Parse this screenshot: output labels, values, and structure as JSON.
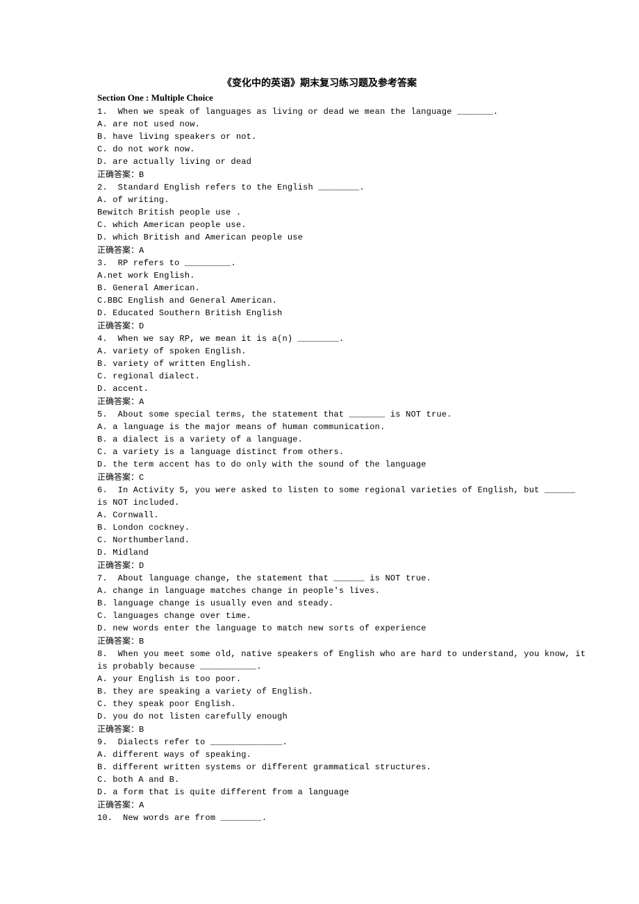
{
  "title": "《变化中的英语》期末复习练习题及参考答案",
  "section_title": "Section One : Multiple Choice",
  "questions": [
    {
      "num": "1.",
      "stem": "When we speak of languages as living or dead we mean the language _______.",
      "opts": [
        "A. are not used now.",
        "B. have living speakers or not.",
        "C. do not work now.",
        "D. are actually living or dead"
      ],
      "ans_label": "正确答案：",
      "ans": "B"
    },
    {
      "num": "2.",
      "stem": "Standard English refers to the English ________.",
      "opts": [
        "A. of writing.",
        "Bewitch British people use .",
        "C. which American people use.",
        "D. which British and American people use"
      ],
      "ans_label": "正确答案：",
      "ans": "A"
    },
    {
      "num": "3.",
      "stem": "RP refers to _________.",
      "opts": [
        "A.net work English.",
        "B. General American.",
        "C.BBC English and General American.",
        "D. Educated Southern British English"
      ],
      "ans_label": "正确答案：",
      "ans": "D"
    },
    {
      "num": "4.",
      "stem": "When we say RP, we mean it is a(n) ________.",
      "opts": [
        "A. variety of spoken English.",
        "B. variety of written English.",
        "C. regional dialect.",
        "D. accent."
      ],
      "ans_label": "正确答案：",
      "ans": "A"
    },
    {
      "num": "5.",
      "stem": "About some special terms, the statement that _______ is NOT true.",
      "opts": [
        "A. a language is the major means of human communication.",
        "B. a dialect is a variety of a language.",
        "C. a variety is a language distinct from others.",
        "D. the term accent has to do only with the sound of the language"
      ],
      "ans_label": "正确答案：",
      "ans": "C"
    },
    {
      "num": "6.",
      "stem": "In Activity 5, you were asked to listen to some regional varieties of English, but ______",
      "stem2": "is NOT included.",
      "opts": [
        "A. Cornwall.",
        "B. London cockney.",
        "C. Northumberland.",
        "D. Midland"
      ],
      "ans_label": "正确答案：",
      "ans": "D"
    },
    {
      "num": "7.",
      "stem": "About language change, the statement that ______ is NOT true.",
      "opts": [
        "A. change in language matches change in people's lives.",
        "B. language change is usually even and steady.",
        "C. languages change over time.",
        "D. new words enter the language to match new sorts of experience"
      ],
      "ans_label": "正确答案：",
      "ans": "B"
    },
    {
      "num": "8.",
      "stem": "When you meet some old, native speakers of English who are hard to understand, you know, it",
      "stem2": "is probably because ___________.",
      "opts": [
        "A. your English is too poor.",
        "B. they are speaking a variety of English.",
        "C. they speak poor English.",
        "D. you do not listen carefully enough"
      ],
      "ans_label": "正确答案：",
      "ans": "B"
    },
    {
      "num": "9.",
      "stem": "Dialects refer to ______________.",
      "opts": [
        "A. different ways of speaking.",
        "B. different written systems or different grammatical structures.",
        "C. both A and B.",
        "D. a form that is quite different from a language"
      ],
      "ans_label": "正确答案：",
      "ans": "A"
    },
    {
      "num": "10.",
      "stem": "New words are from ________.",
      "opts": [],
      "ans_label": "",
      "ans": ""
    }
  ]
}
